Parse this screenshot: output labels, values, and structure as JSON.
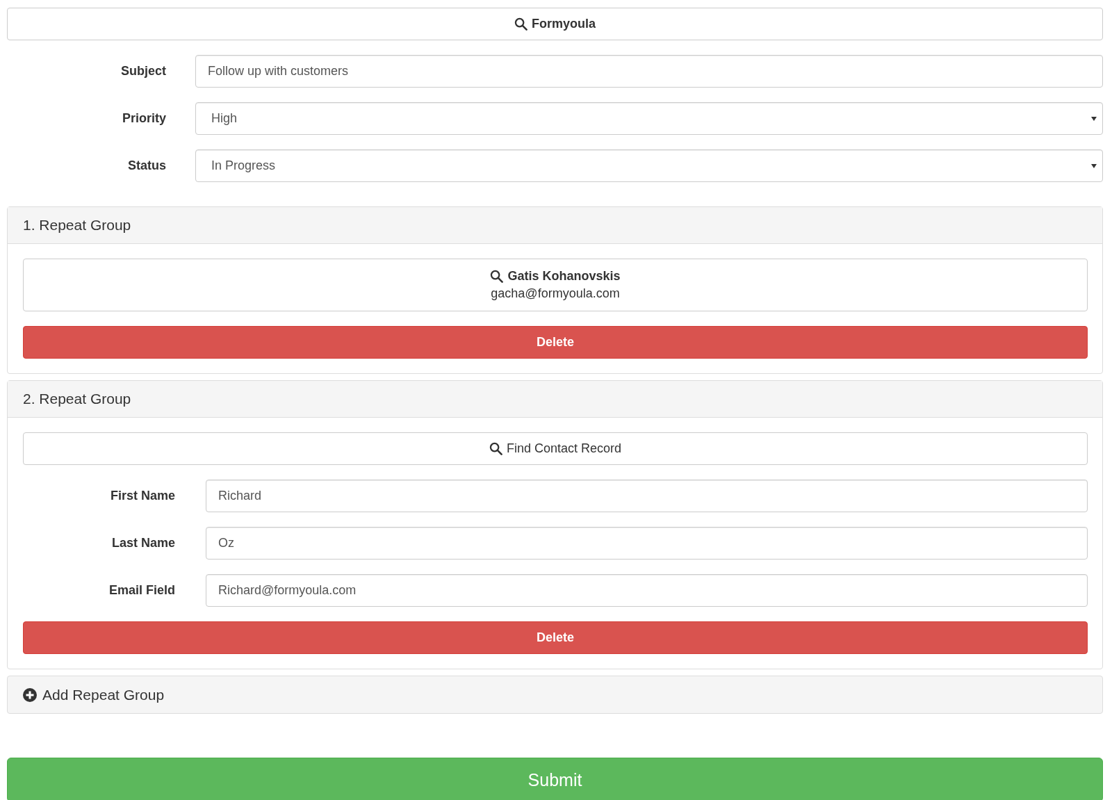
{
  "lookup_button": {
    "label": "Formyoula"
  },
  "fields": [
    {
      "kind": "text",
      "label": "Subject",
      "value": "Follow up with customers"
    },
    {
      "kind": "select",
      "label": "Priority",
      "value": "High"
    },
    {
      "kind": "select",
      "label": "Status",
      "value": "In Progress"
    }
  ],
  "repeat_groups": [
    {
      "title": "1. Repeat Group",
      "lookup": {
        "kind": "selected",
        "name": "Gatis Kohanovskis",
        "email": "gacha@formyoula.com"
      },
      "delete_button": "Delete"
    },
    {
      "title": "2. Repeat Group",
      "lookup": {
        "kind": "empty",
        "label": "Find Contact Record"
      },
      "fields": [
        {
          "kind": "text",
          "label": "First Name",
          "value": "Richard"
        },
        {
          "kind": "text",
          "label": "Last Name",
          "value": "Oz"
        },
        {
          "kind": "text",
          "label": "Email Field",
          "value": "Richard@formyoula.com"
        }
      ],
      "delete_button": "Delete"
    }
  ],
  "add_group_button": "Add Repeat Group",
  "submit_button": "Submit"
}
